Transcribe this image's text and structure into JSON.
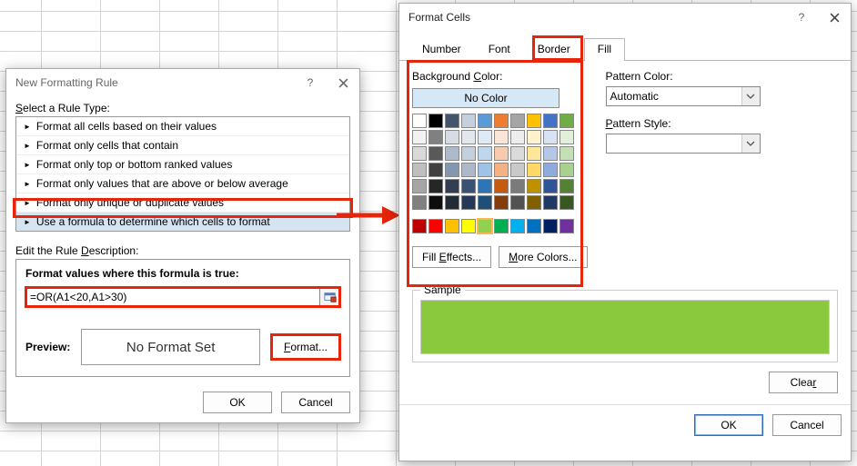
{
  "ruleDialog": {
    "title": "New Formatting Rule",
    "selectRule": "Select a Rule Type:",
    "rules": [
      "Format all cells based on their values",
      "Format only cells that contain",
      "Format only top or bottom ranked values",
      "Format only values that are above or below average",
      "Format only unique or duplicate values",
      "Use a formula to determine which cells to format"
    ],
    "editDesc": "Edit the Rule Description:",
    "formulaTitle": "Format values where this formula is true:",
    "formula": "=OR(A1<20,A1>30)",
    "previewLabel": "Preview:",
    "previewText": "No Format Set",
    "format": "Format...",
    "ok": "OK",
    "cancel": "Cancel"
  },
  "fcDialog": {
    "title": "Format Cells",
    "tabs": [
      "Number",
      "Font",
      "Border",
      "Fill"
    ],
    "activeTab": "Fill",
    "bgLabel": "Background Color:",
    "leadA": "C",
    "noColor": "No Color",
    "fillEffects": "Fill Effects...",
    "moreColors": "More Colors...",
    "patColorLabel": "Pattern Color:",
    "patColorAccel": "A",
    "patColorValue": "Automatic",
    "patStyleLabel": "Pattern Style:",
    "patStyleAccel": "P",
    "sampleLabel": "Sample",
    "clear": "Clear",
    "ok": "OK",
    "cancel": "Cancel",
    "sampleColor": "#8ac93d",
    "themeColors": [
      "#ffffff",
      "#000000",
      "#44546a",
      "#c6d0dc",
      "#5b9bd5",
      "#ed7d31",
      "#a5a5a5",
      "#ffc000",
      "#4472c4",
      "#70ad47",
      "#f2f2f2",
      "#808080",
      "#d6dce5",
      "#e2e7ee",
      "#deebf7",
      "#fbe5d6",
      "#ededed",
      "#fff2cc",
      "#d9e2f3",
      "#e2efda",
      "#d9d9d9",
      "#595959",
      "#aeb9ca",
      "#c6cfdc",
      "#bdd7ee",
      "#f8cbad",
      "#dbdbdb",
      "#ffe699",
      "#b4c7e7",
      "#c5e0b4",
      "#bfbfbf",
      "#404040",
      "#8497b0",
      "#adb9ca",
      "#9dc3e6",
      "#f4b183",
      "#c9c9c9",
      "#ffd966",
      "#8faadc",
      "#a9d18e",
      "#a6a6a6",
      "#262626",
      "#333f50",
      "#395173",
      "#2e75b6",
      "#c55a11",
      "#7b7b7b",
      "#bf9000",
      "#2f5597",
      "#548235",
      "#808080",
      "#0d0d0d",
      "#222a35",
      "#263857",
      "#1f4e79",
      "#843c0c",
      "#525252",
      "#806000",
      "#203864",
      "#385723"
    ],
    "stdColors": [
      "#c00000",
      "#ff0000",
      "#ffc000",
      "#ffff00",
      "#92d050",
      "#00b050",
      "#00b0f0",
      "#0070c0",
      "#002060",
      "#7030a0"
    ]
  }
}
